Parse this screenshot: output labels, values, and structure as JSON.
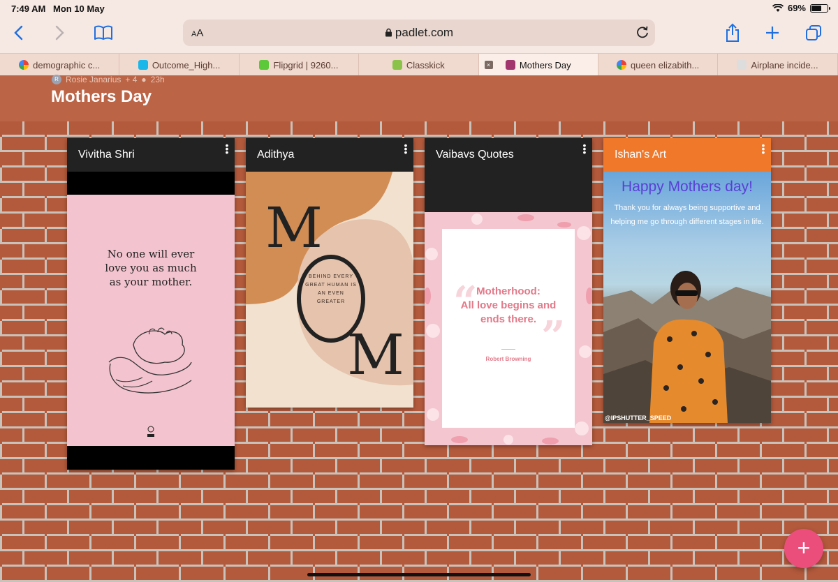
{
  "status": {
    "time": "7:49 AM",
    "date": "Mon 10 May",
    "battery_percent": "69%",
    "battery_level": 0.69
  },
  "toolbar": {
    "aa_label": "AA",
    "domain": "padlet.com"
  },
  "tabs": [
    {
      "label": "demographic c...",
      "icon": "google-icon",
      "color": "#4285f4"
    },
    {
      "label": "Outcome_High...",
      "icon": "vimeo-icon",
      "color": "#1ab7ea"
    },
    {
      "label": "Flipgrid | 9260...",
      "icon": "flipgrid-icon",
      "color": "#5cc93b"
    },
    {
      "label": "Classkick",
      "icon": "classkick-icon",
      "color": "#8bc34a"
    },
    {
      "label": "Mothers Day",
      "icon": "padlet-icon",
      "color": "#a2356e",
      "active": true
    },
    {
      "label": "queen elizabith...",
      "icon": "google-icon",
      "color": "#4285f4"
    },
    {
      "label": "Airplane incide...",
      "icon": "page-icon",
      "color": "#dddddd"
    }
  ],
  "header": {
    "author": "Rosie Janarius",
    "avatar_letter": "R",
    "collaborators": "+ 4",
    "age": "23h",
    "title": "Mothers Day"
  },
  "cards": [
    {
      "title": "Vivitha Shri",
      "quote_lines": [
        "No one will ever",
        "love you as much",
        "as your mother."
      ]
    },
    {
      "title": "Adithya",
      "quote": "BEHIND EVERY GREAT HUMAN IS AN EVEN GREATER",
      "letters": [
        "M",
        "O",
        "M"
      ]
    },
    {
      "title": "Vaibavs Quotes",
      "quote_lines": [
        "Motherhood:",
        "All love begins and",
        "ends there."
      ],
      "author": "Robert Browning"
    },
    {
      "title": "Ishan's Art",
      "heading": "Happy Mothers day!",
      "message": "Thank you for always being supportive and helping me go through different stages in life.",
      "credit": "@IPSHUTTER_SPEED"
    }
  ],
  "fab_label": "+",
  "colors": {
    "header_bg": "#bb6446",
    "accent_pink": "#ec4e7c",
    "ishan_header": "#f0782a",
    "safari_blue": "#1f6fe0"
  }
}
